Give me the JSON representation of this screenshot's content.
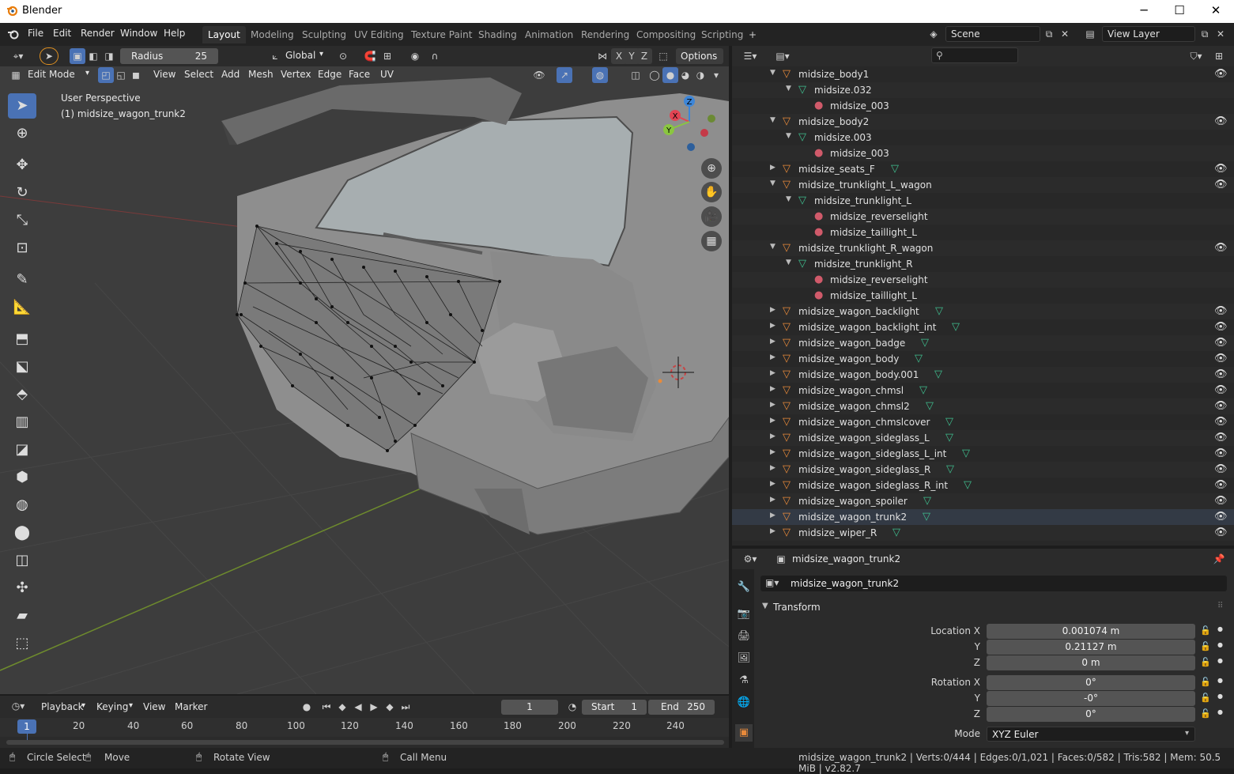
{
  "window": {
    "title": "Blender",
    "controls": [
      "─",
      "☐",
      "✕"
    ]
  },
  "menu": [
    "File",
    "Edit",
    "Render",
    "Window",
    "Help"
  ],
  "workspaces": [
    "Layout",
    "Modeling",
    "Sculpting",
    "UV Editing",
    "Texture Paint",
    "Shading",
    "Animation",
    "Rendering",
    "Compositing",
    "Scripting"
  ],
  "scene": {
    "scene_name": "Scene",
    "view_layer": "View Layer"
  },
  "viewport": {
    "radius_label": "Radius",
    "radius_value": "25",
    "transform_orientation": "Global",
    "options_label": "Options",
    "mode": "Edit Mode",
    "header_menus": [
      "View",
      "Select",
      "Add",
      "Mesh",
      "Vertex",
      "Edge",
      "Face",
      "UV"
    ],
    "axes": [
      "X",
      "Y",
      "Z"
    ],
    "overlay_line1": "User Perspective",
    "overlay_line2": "(1) midsize_wagon_trunk2",
    "gizmo": {
      "x": "X",
      "y": "Y",
      "z": "Z"
    }
  },
  "timeline": {
    "menus": [
      "Playback",
      "Keying",
      "View",
      "Marker"
    ],
    "current_frame": "1",
    "start_label": "Start",
    "start_value": "1",
    "end_label": "End",
    "end_value": "250",
    "playhead": "1",
    "ticks": [
      "20",
      "40",
      "60",
      "80",
      "100",
      "120",
      "140",
      "160",
      "180",
      "200",
      "220",
      "240"
    ]
  },
  "status": {
    "circle_select": "Circle Select",
    "move": "Move",
    "rotate_view": "Rotate View",
    "call_menu": "Call Menu",
    "stats": "midsize_wagon_trunk2 | Verts:0/444 | Edges:0/1,021 | Faces:0/582 | Tris:582 | Mem: 50.5 MiB | v2.82.7"
  },
  "outliner": {
    "rows": [
      {
        "label": "midsize_body1",
        "indent": 0,
        "type": "object",
        "expanded": true,
        "eye": true
      },
      {
        "label": "midsize.032",
        "indent": 1,
        "type": "mesh",
        "expanded": true,
        "eye": false
      },
      {
        "label": "midsize_003",
        "indent": 2,
        "type": "material",
        "eye": false
      },
      {
        "label": "midsize_body2",
        "indent": 0,
        "type": "object",
        "expanded": true,
        "eye": true
      },
      {
        "label": "midsize.003",
        "indent": 1,
        "type": "mesh",
        "expanded": true,
        "eye": false
      },
      {
        "label": "midsize_003",
        "indent": 2,
        "type": "material",
        "eye": false
      },
      {
        "label": "midsize_seats_F",
        "indent": 0,
        "type": "object",
        "expanded": false,
        "eye": true,
        "mesh_icon": true
      },
      {
        "label": "midsize_trunklight_L_wagon",
        "indent": 0,
        "type": "object",
        "expanded": true,
        "eye": true
      },
      {
        "label": "midsize_trunklight_L",
        "indent": 1,
        "type": "mesh",
        "expanded": true,
        "eye": false
      },
      {
        "label": "midsize_reverselight",
        "indent": 2,
        "type": "material",
        "eye": false
      },
      {
        "label": "midsize_taillight_L",
        "indent": 2,
        "type": "material",
        "eye": false
      },
      {
        "label": "midsize_trunklight_R_wagon",
        "indent": 0,
        "type": "object",
        "expanded": true,
        "eye": true
      },
      {
        "label": "midsize_trunklight_R",
        "indent": 1,
        "type": "mesh",
        "expanded": true,
        "eye": false
      },
      {
        "label": "midsize_reverselight",
        "indent": 2,
        "type": "material",
        "eye": false
      },
      {
        "label": "midsize_taillight_L",
        "indent": 2,
        "type": "material",
        "eye": false
      },
      {
        "label": "midsize_wagon_backlight",
        "indent": 0,
        "type": "object",
        "expanded": false,
        "eye": true,
        "mesh_icon": true
      },
      {
        "label": "midsize_wagon_backlight_int",
        "indent": 0,
        "type": "object",
        "expanded": false,
        "eye": true,
        "mesh_icon": true
      },
      {
        "label": "midsize_wagon_badge",
        "indent": 0,
        "type": "object",
        "expanded": false,
        "eye": true,
        "mesh_icon": true
      },
      {
        "label": "midsize_wagon_body",
        "indent": 0,
        "type": "object",
        "expanded": false,
        "eye": true,
        "mesh_icon": true
      },
      {
        "label": "midsize_wagon_body.001",
        "indent": 0,
        "type": "object",
        "expanded": false,
        "eye": true,
        "mesh_icon": true
      },
      {
        "label": "midsize_wagon_chmsl",
        "indent": 0,
        "type": "object",
        "expanded": false,
        "eye": true,
        "mesh_icon": true
      },
      {
        "label": "midsize_wagon_chmsl2",
        "indent": 0,
        "type": "object",
        "expanded": false,
        "eye": true,
        "mesh_icon": true
      },
      {
        "label": "midsize_wagon_chmslcover",
        "indent": 0,
        "type": "object",
        "expanded": false,
        "eye": true,
        "mesh_icon": true
      },
      {
        "label": "midsize_wagon_sideglass_L",
        "indent": 0,
        "type": "object",
        "expanded": false,
        "eye": true,
        "mesh_icon": true
      },
      {
        "label": "midsize_wagon_sideglass_L_int",
        "indent": 0,
        "type": "object",
        "expanded": false,
        "eye": true,
        "mesh_icon": true
      },
      {
        "label": "midsize_wagon_sideglass_R",
        "indent": 0,
        "type": "object",
        "expanded": false,
        "eye": true,
        "mesh_icon": true
      },
      {
        "label": "midsize_wagon_sideglass_R_int",
        "indent": 0,
        "type": "object",
        "expanded": false,
        "eye": true,
        "mesh_icon": true
      },
      {
        "label": "midsize_wagon_spoiler",
        "indent": 0,
        "type": "object",
        "expanded": false,
        "eye": true,
        "mesh_icon": true
      },
      {
        "label": "midsize_wagon_trunk2",
        "indent": 0,
        "type": "object",
        "expanded": false,
        "eye": true,
        "mesh_icon": true,
        "selected": true
      },
      {
        "label": "midsize_wiper_R",
        "indent": 0,
        "type": "object",
        "expanded": false,
        "eye": true,
        "mesh_icon": true
      }
    ]
  },
  "properties": {
    "object_name_header": "midsize_wagon_trunk2",
    "object_name_field": "midsize_wagon_trunk2",
    "panel": "Transform",
    "location_label": "Location X",
    "loc_x": "0.001074 m",
    "loc_y": "0.21127 m",
    "loc_z": "0 m",
    "rotation_label": "Rotation X",
    "rot_x": "0°",
    "rot_y": "-0°",
    "rot_z": "0°",
    "y_label": "Y",
    "z_label": "Z",
    "mode_label": "Mode",
    "mode_value": "XYZ Euler"
  },
  "colors": {
    "accent_blue": "#4a72b5",
    "object_orange": "#e88a3a",
    "mesh_green": "#3fbf8f",
    "material_red": "#d05a6a",
    "axis_x": "#e24453",
    "axis_y": "#8ac640",
    "axis_z": "#3d86d8"
  }
}
